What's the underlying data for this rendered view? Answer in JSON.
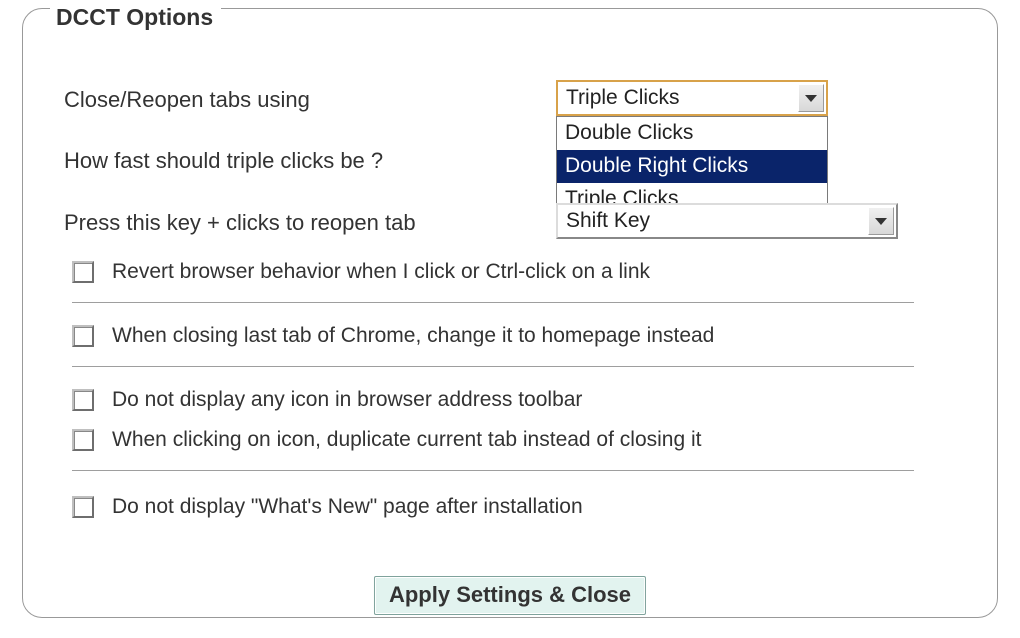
{
  "legend": "DCCT Options",
  "rows": {
    "close_reopen_label": "Close/Reopen tabs using",
    "speed_label": "How fast should triple clicks be ?",
    "reopen_key_label": "Press this key + clicks to reopen tab"
  },
  "close_reopen_select": {
    "value": "Triple Clicks",
    "options": [
      "Double Clicks",
      "Double Right Clicks",
      "Triple Clicks"
    ],
    "highlighted_index": 1
  },
  "reopen_key_select": {
    "value": "Shift Key"
  },
  "checks": [
    {
      "label": "Revert browser behavior when I click or Ctrl-click on a link",
      "checked": false
    },
    {
      "label": "When closing last tab of Chrome, change it to homepage instead",
      "checked": false
    },
    {
      "label": "Do not display any icon in browser address toolbar",
      "checked": false
    },
    {
      "label": "When clicking on icon, duplicate current tab instead of closing it",
      "checked": false
    },
    {
      "label": "Do not display \"What's New\" page after installation",
      "checked": false
    }
  ],
  "apply_label": "Apply Settings & Close"
}
